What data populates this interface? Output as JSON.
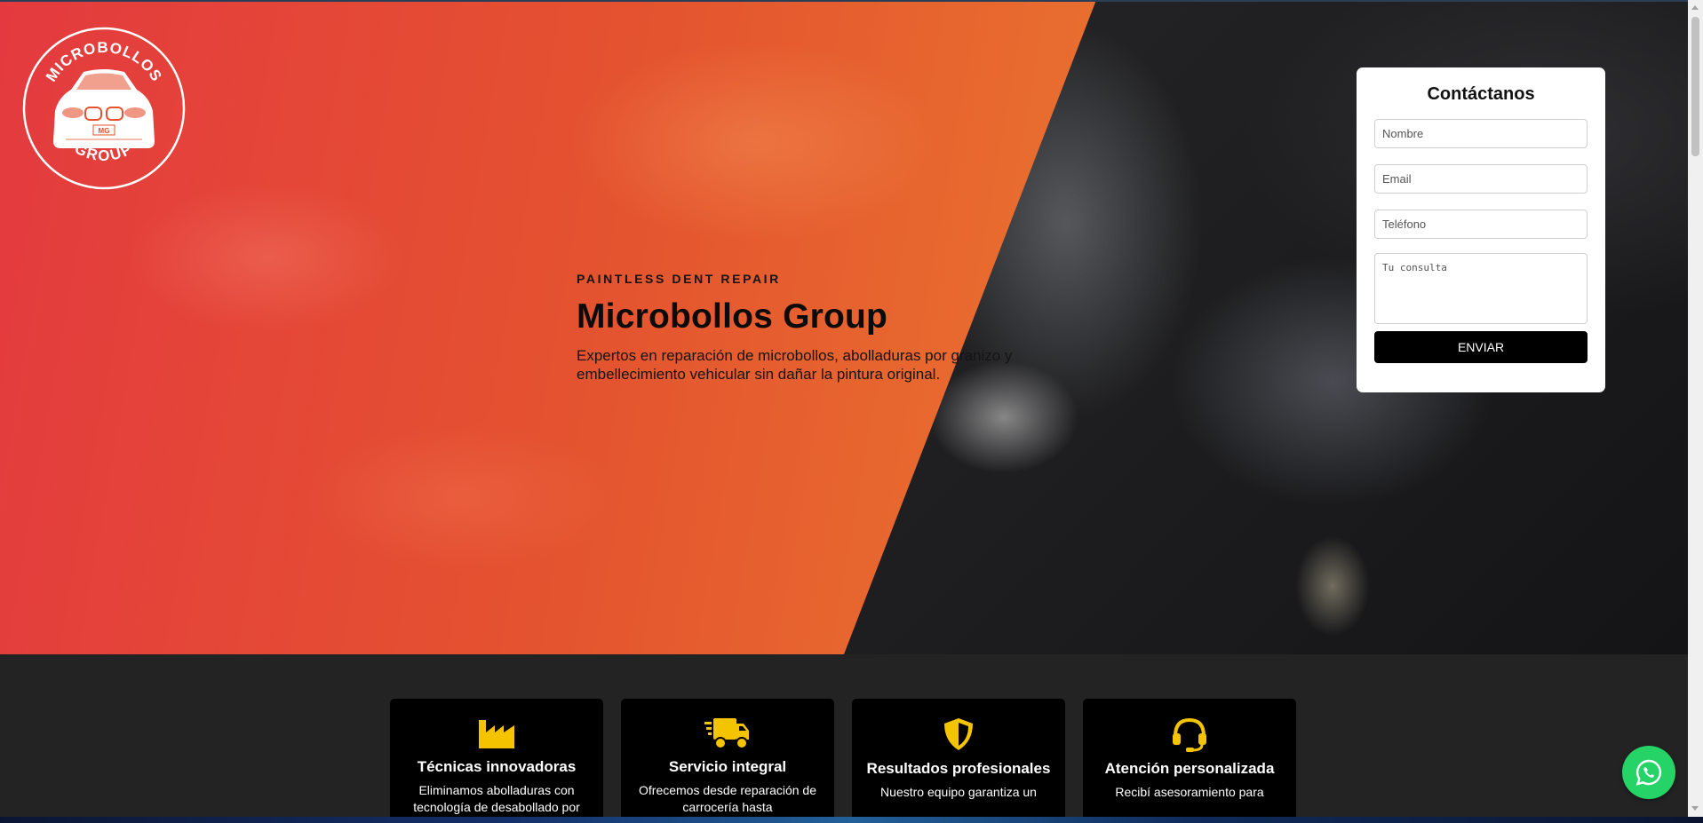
{
  "brand": {
    "logo_text_top": "MICROBOLLOS",
    "logo_text_bottom": "GROUP",
    "logo_plate": "MG"
  },
  "hero": {
    "eyebrow": "PAINTLESS DENT REPAIR",
    "title": "Microbollos Group",
    "description": "Expertos en reparación de microbollos, abolladuras por granizo y embellecimiento vehicular sin dañar la pintura original."
  },
  "contact": {
    "title": "Contáctanos",
    "name_placeholder": "Nombre",
    "email_placeholder": "Email",
    "phone_placeholder": "Teléfono",
    "message_placeholder": "Tu consulta",
    "submit_label": "ENVIAR"
  },
  "features": [
    {
      "icon": "factory-icon",
      "title": "Técnicas innovadoras",
      "text": "Eliminamos abolladuras con tecnología de desabollado por"
    },
    {
      "icon": "delivery-truck-icon",
      "title": "Servicio integral",
      "text": "Ofrecemos desde reparación de carrocería hasta"
    },
    {
      "icon": "shield-icon",
      "title": "Resultados profesionales",
      "text": "Nuestro equipo garantiza un"
    },
    {
      "icon": "headset-icon",
      "title": "Atención personalizada",
      "text": "Recibí asesoramiento para"
    }
  ],
  "colors": {
    "hero_gradient_start": "#e43a3f",
    "hero_gradient_end": "#f08f1f",
    "feature_icon": "#f5c400",
    "whatsapp": "#25d366",
    "dark_background": "#232323"
  },
  "floating": {
    "whatsapp_icon": "whatsapp-icon"
  }
}
